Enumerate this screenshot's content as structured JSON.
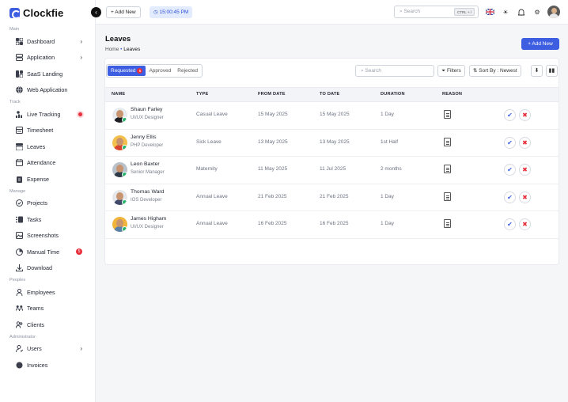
{
  "app": {
    "name": "Clockfie"
  },
  "header": {
    "add_new": "+ Add New",
    "clock": "15:00:45 PM",
    "search_placeholder": "Search",
    "shortcut": "CTRL + /"
  },
  "sidebar": {
    "sections": [
      {
        "title": "Main",
        "items": [
          {
            "label": "Dashboard",
            "icon": "grid-icon",
            "chevron": true
          },
          {
            "label": "Application",
            "icon": "layers-icon",
            "chevron": true
          },
          {
            "label": "SaaS Landing",
            "icon": "landing-icon"
          },
          {
            "label": "Web Application",
            "icon": "globe-icon"
          }
        ]
      },
      {
        "title": "Track",
        "items": [
          {
            "label": "Live Tracking",
            "icon": "tracking-icon",
            "dot": true
          },
          {
            "label": "Timesheet",
            "icon": "timesheet-icon"
          },
          {
            "label": "Leaves",
            "icon": "leaves-icon"
          },
          {
            "label": "Attendance",
            "icon": "calendar-icon"
          },
          {
            "label": "Expense",
            "icon": "expense-icon"
          }
        ]
      },
      {
        "title": "Manage",
        "items": [
          {
            "label": "Projects",
            "icon": "projects-icon"
          },
          {
            "label": "Tasks",
            "icon": "tasks-icon"
          },
          {
            "label": "Screenshots",
            "icon": "screenshots-icon"
          },
          {
            "label": "Manual Time",
            "icon": "clock-icon",
            "count": "5"
          },
          {
            "label": "Download",
            "icon": "download-icon"
          }
        ]
      },
      {
        "title": "Peoples",
        "items": [
          {
            "label": "Employees",
            "icon": "employees-icon"
          },
          {
            "label": "Teams",
            "icon": "teams-icon"
          },
          {
            "label": "Clients",
            "icon": "clients-icon"
          }
        ]
      },
      {
        "title": "Administrator",
        "items": [
          {
            "label": "Users",
            "icon": "users-icon",
            "chevron": true
          },
          {
            "label": "Invoices",
            "icon": "invoices-icon"
          }
        ]
      }
    ]
  },
  "page": {
    "title": "Leaves",
    "breadcrumb_home": "Home",
    "breadcrumb_current": "Leaves",
    "add_new": "+ Add New"
  },
  "toolbar": {
    "tabs": [
      {
        "label": "Requested",
        "badge": "5"
      },
      {
        "label": "Approved"
      },
      {
        "label": "Rejected"
      }
    ],
    "search_placeholder": "Search",
    "filters": "Filters",
    "sort": "Sort By : Newest"
  },
  "table": {
    "columns": [
      "NAME",
      "TYPE",
      "FROM DATE",
      "TO DATE",
      "DURATION",
      "REASON"
    ],
    "rows": [
      {
        "name": "Shaun Farley",
        "role": "UI/UX Designer",
        "type": "Casual Leave",
        "from": "15 May 2025",
        "to": "15 May 2025",
        "duration": "1 Day",
        "avatar_bg": "#e9ecef",
        "shirt": "#1d1f24"
      },
      {
        "name": "Jenny Ellis",
        "role": "PHP Developer",
        "type": "Sick Leave",
        "from": "13 May 2025",
        "to": "13 May 2025",
        "duration": "1st Half",
        "avatar_bg": "#f3c14b",
        "shirt": "#d9442e"
      },
      {
        "name": "Leon Baxter",
        "role": "Senior Manager",
        "type": "Maternity",
        "from": "11 May 2025",
        "to": "11 Jul 2025",
        "duration": "2 months",
        "avatar_bg": "#b9c1ca",
        "shirt": "#2f3a48"
      },
      {
        "name": "Thomas Ward",
        "role": "IOS Developer",
        "type": "Annual Leave",
        "from": "21 Feb 2025",
        "to": "21 Feb 2025",
        "duration": "1 Day",
        "avatar_bg": "#e6e7ea",
        "shirt": "#3f4a6a"
      },
      {
        "name": "James Higham",
        "role": "UI/UX Designer",
        "type": "Annual Leave",
        "from": "16 Feb 2025",
        "to": "16 Feb 2025",
        "duration": "1 Day",
        "avatar_bg": "#f1b43a",
        "shirt": "#5a7fa8"
      }
    ]
  }
}
